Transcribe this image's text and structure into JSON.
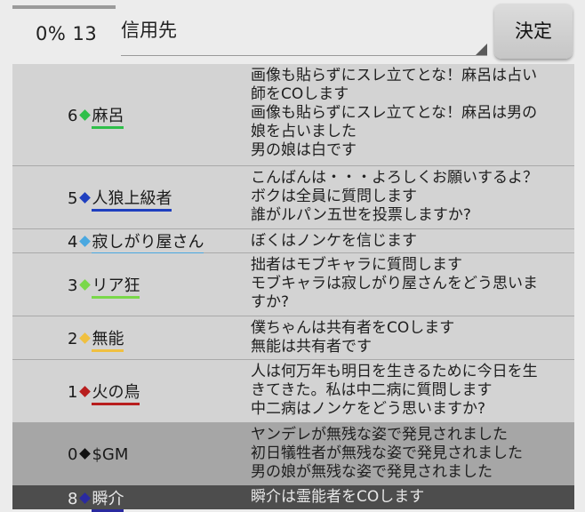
{
  "header": {
    "counter_text": "0% 13",
    "target_label": "信用先",
    "decide_label": "決定"
  },
  "log": [
    {
      "number": "6",
      "name": "麻呂",
      "color": "#2fbf4a",
      "underline": "#2fbf4a",
      "lines": [
        "画像も貼らずにスレ立てとな！麻呂は占い",
        "師をCOします",
        "画像も貼らずにスレ立てとな！麻呂は男の",
        "娘を占いました",
        "男の娘は白です"
      ]
    },
    {
      "number": "5",
      "name": "人狼上級者",
      "color": "#1f3fbf",
      "underline": "#1f3fbf",
      "lines": [
        "こんばんは・・・よろしくお願いするよ？",
        "ボクは全員に質問します",
        "誰がルパン五世を投票しますか?"
      ]
    },
    {
      "number": "4",
      "name": "寂しがり屋さん",
      "color": "#4aa8e0",
      "underline": "#4aa8e0",
      "lines": [
        "ぼくはノンケを信じます"
      ]
    },
    {
      "number": "3",
      "name": "リア狂",
      "color": "#7ad84a",
      "underline": "#7ad84a",
      "lines": [
        "拙者はモブキャラに質問します",
        "モブキャラは寂しがり屋さんをどう思いま",
        "すか?"
      ]
    },
    {
      "number": "2",
      "name": "無能",
      "color": "#f0c040",
      "underline": "#f0c040",
      "lines": [
        "僕ちゃんは共有者をCOします",
        "無能は共有者です"
      ]
    },
    {
      "number": "1",
      "name": "火の鳥",
      "color": "#b81e1e",
      "underline": "#b81e1e",
      "lines": [
        "人は何万年も明日を生きるために今日を生",
        "きてきた。私は中二病に質問します",
        "中二病はノンケをどう思いますか?"
      ]
    },
    {
      "number": "0",
      "name": "$GM",
      "color": "#111111",
      "underline": "",
      "style": "gm",
      "lines": [
        "ヤンデレが無残な姿で発見されました",
        "初日犠牲者が無残な姿で発見されました",
        "男の娘が無残な姿で発見されました"
      ]
    },
    {
      "number": "8",
      "name": "瞬介",
      "color": "#2a2aa0",
      "underline": "#2a2aa0",
      "style": "dark",
      "lines": [
        "瞬介は霊能者をCOします"
      ]
    }
  ]
}
